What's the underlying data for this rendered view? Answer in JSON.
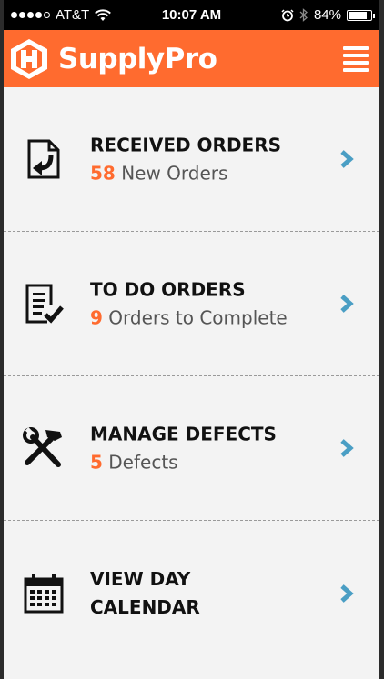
{
  "status_bar": {
    "carrier": "AT&T",
    "time": "10:07 AM",
    "battery": "84%",
    "battery_level": 0.84,
    "icons": [
      "signal-dots-icon",
      "wifi-icon",
      "alarm-clock-icon",
      "bluetooth-icon",
      "battery-icon"
    ]
  },
  "header": {
    "app_name": "SupplyPro",
    "logo_icon": "supplypro-logo-icon",
    "menu_icon": "hamburger-menu-icon"
  },
  "menu": {
    "items": [
      {
        "title": "RECEIVED ORDERS",
        "count": "58",
        "subtitle": "New Orders",
        "icon": "document-import-icon"
      },
      {
        "title": "TO DO ORDERS",
        "count": "9",
        "subtitle": "Orders to Complete",
        "icon": "checklist-icon"
      },
      {
        "title": "MANAGE DEFECTS",
        "count": "5",
        "subtitle": "Defects",
        "icon": "tools-icon"
      },
      {
        "title_line1": "VIEW DAY",
        "title_line2": "CALENDAR",
        "icon": "calendar-icon"
      }
    ]
  },
  "colors": {
    "brand": "#ff6b2f",
    "chevron": "#4a9ec4",
    "background": "#f3f3f3"
  }
}
